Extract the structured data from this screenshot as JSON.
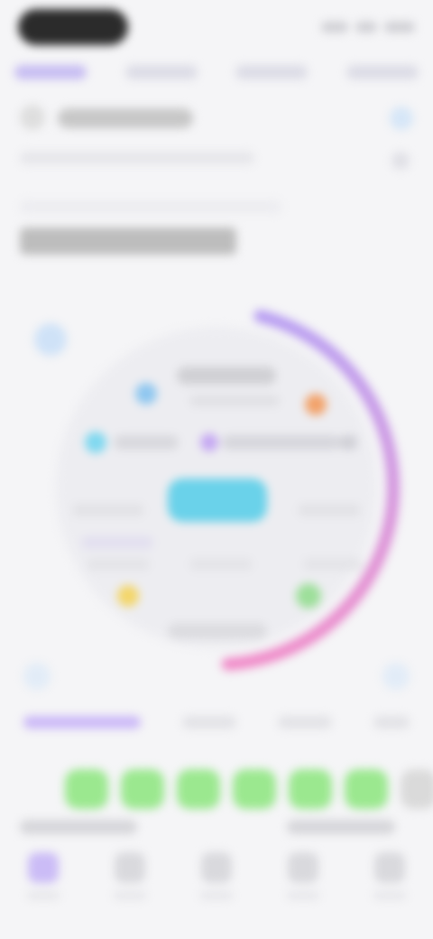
{
  "colors": {
    "background": "#f5f5f7",
    "accent": "#c7bdf2",
    "dial_arc_start": "#b79df2",
    "dial_arc_end": "#f08ac8",
    "center_pill": "#6ad2ea",
    "week_active": "#9be88f"
  },
  "tabs": [
    {
      "icon": "tab-icon",
      "active": true
    },
    {
      "icon": "tab-icon",
      "active": false
    },
    {
      "icon": "tab-icon",
      "active": false
    },
    {
      "icon": "tab-icon",
      "active": false
    }
  ],
  "dial": {
    "progress": 0.45,
    "center_value": "",
    "items": [
      {
        "icon": "dial-icon",
        "color": "#8fc7f0"
      },
      {
        "icon": "dial-icon",
        "color": "#f2a26a"
      },
      {
        "icon": "dial-icon",
        "color": "#7fd8f0"
      },
      {
        "icon": "dial-icon",
        "color": "#c5a8f2"
      },
      {
        "icon": "dial-icon",
        "color": "#f3d66a"
      },
      {
        "icon": "dial-icon",
        "color": "#9ddf9a"
      }
    ]
  },
  "week_strip": {
    "days": [
      true,
      true,
      true,
      true,
      true,
      true,
      false
    ]
  },
  "nav": [
    {
      "icon": "home-icon",
      "active": true
    },
    {
      "icon": "calendar-icon",
      "active": false
    },
    {
      "icon": "chart-icon",
      "active": false
    },
    {
      "icon": "trophy-icon",
      "active": false
    },
    {
      "icon": "profile-icon",
      "active": false
    }
  ]
}
